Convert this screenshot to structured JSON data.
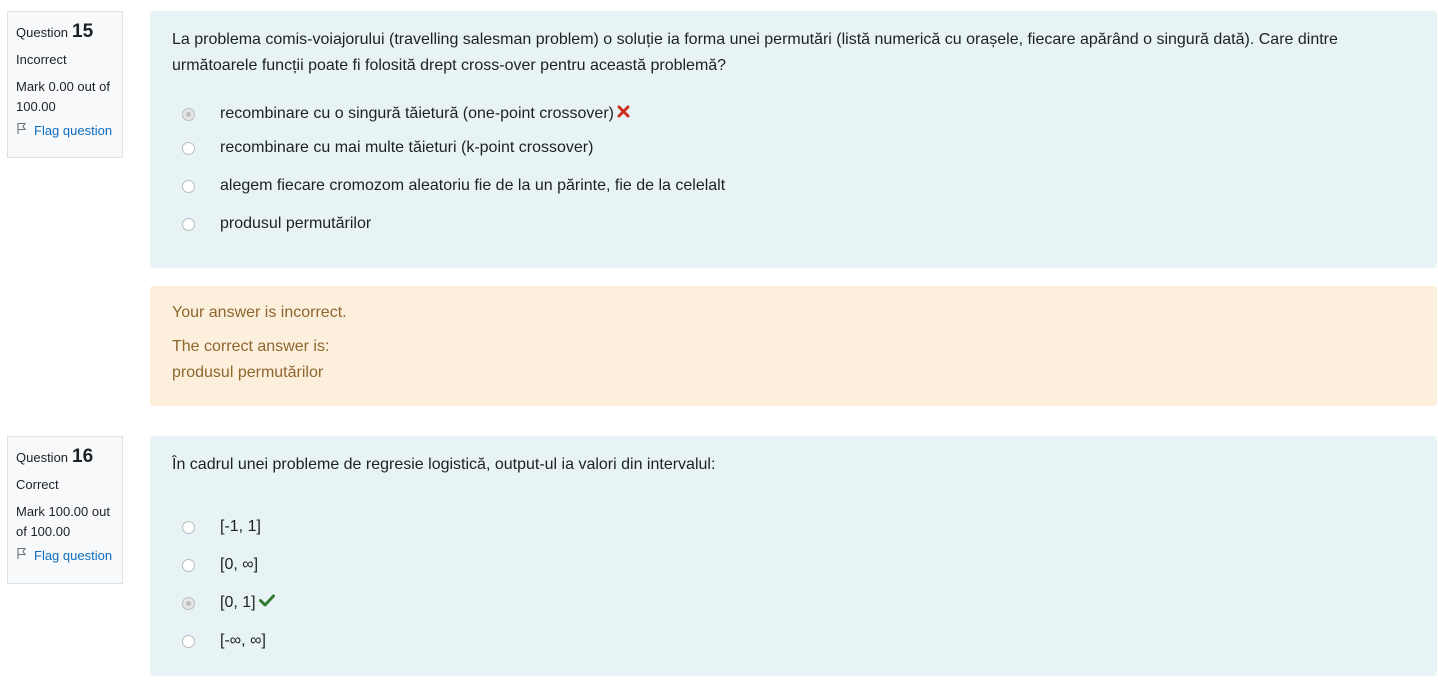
{
  "q15": {
    "label": "Question",
    "number": "15",
    "state": "Incorrect",
    "grade": "Mark 0.00 out of 100.00",
    "flag_label": "Flag question",
    "text": "La problema comis-voiajorului (travelling salesman problem) o soluție ia forma unei permutări (listă numerică cu orașele, fiecare apărând o singură dată). Care dintre următoarele funcții poate fi folosită drept cross-over pentru această problemă?",
    "answers": [
      "recombinare cu o singură tăietură (one-point crossover)",
      "recombinare cu mai multe tăieturi (k-point crossover)",
      "alegem fiecare cromozom aleatoriu fie de la un părinte, fie de la celelalt",
      "produsul permutărilor"
    ],
    "selected_index": 0,
    "feedback": {
      "message": "Your answer is incorrect.",
      "correct_label": "The correct answer is:",
      "correct_answer": "produsul permutărilor"
    }
  },
  "q16": {
    "label": "Question",
    "number": "16",
    "state": "Correct",
    "grade": "Mark 100.00 out of 100.00",
    "flag_label": "Flag question",
    "text": "În cadrul unei probleme de regresie logistică, output-ul ia valori din intervalul:",
    "answers": [
      "[-1, 1]",
      "[0, ∞]",
      "[0, 1]",
      "[-∞, ∞]"
    ],
    "selected_index": 2
  },
  "icons": {
    "flag": "flag-icon",
    "incorrect": "cross-icon",
    "correct": "check-icon"
  },
  "colors": {
    "formulation_bg": "#e7f3f5",
    "feedback_bg": "#fcefdc",
    "feedback_text": "#8e662e",
    "link": "#0f6cbf",
    "incorrect": "#ca3120",
    "correct": "#357a32"
  }
}
